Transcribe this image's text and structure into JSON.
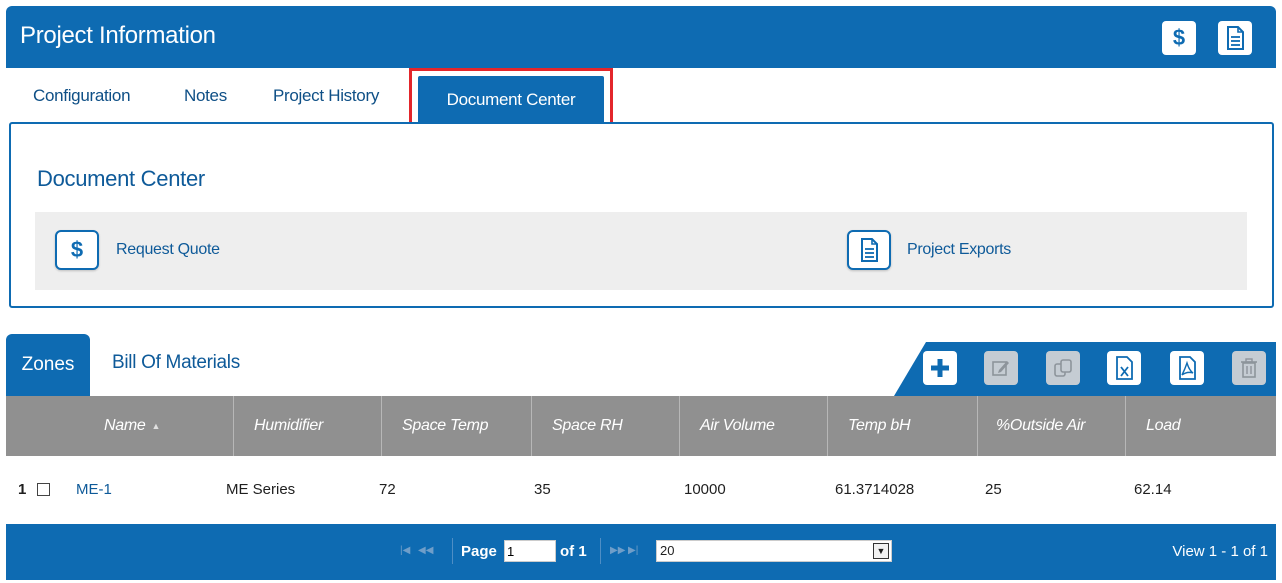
{
  "header": {
    "title": "Project Information",
    "quote_icon": "dollar-icon",
    "doc_icon": "document-icon",
    "dollar_glyph": "$"
  },
  "tabs": [
    {
      "label": "Configuration"
    },
    {
      "label": "Notes"
    },
    {
      "label": "Project History"
    },
    {
      "label": "Document Center",
      "active": true
    }
  ],
  "document_center": {
    "title": "Document Center",
    "actions": [
      {
        "label": "Request Quote",
        "icon": "dollar-icon"
      },
      {
        "label": "Project Exports",
        "icon": "document-icon"
      }
    ]
  },
  "grid": {
    "tabs": [
      {
        "label": "Zones",
        "active": true
      },
      {
        "label": "Bill Of Materials"
      }
    ],
    "toolbar": [
      {
        "icon": "add-icon",
        "enabled": true
      },
      {
        "icon": "edit-icon",
        "enabled": false
      },
      {
        "icon": "copy-icon",
        "enabled": false
      },
      {
        "icon": "excel-export-icon",
        "enabled": true
      },
      {
        "icon": "pdf-export-icon",
        "enabled": true
      },
      {
        "icon": "delete-icon",
        "enabled": false
      }
    ],
    "columns": [
      "Name",
      "Humidifier",
      "Space Temp",
      "Space RH",
      "Air Volume",
      "Temp bH",
      "%Outside Air",
      "Load"
    ],
    "rows": [
      {
        "num": "1",
        "name": "ME-1",
        "humidifier": "ME Series",
        "space_temp": "72",
        "space_rh": "35",
        "air_volume": "10000",
        "temp_bh": "61.3714028",
        "outside_air": "25",
        "load": "62.14"
      }
    ]
  },
  "pager": {
    "page_label": "Page",
    "page_value": "1",
    "of_label": "of 1",
    "page_size": "20",
    "view_text": "View 1 - 1 of 1"
  },
  "colors": {
    "primary": "#0e6bb2",
    "highlight": "#e3262b",
    "grid_header": "#909090"
  }
}
